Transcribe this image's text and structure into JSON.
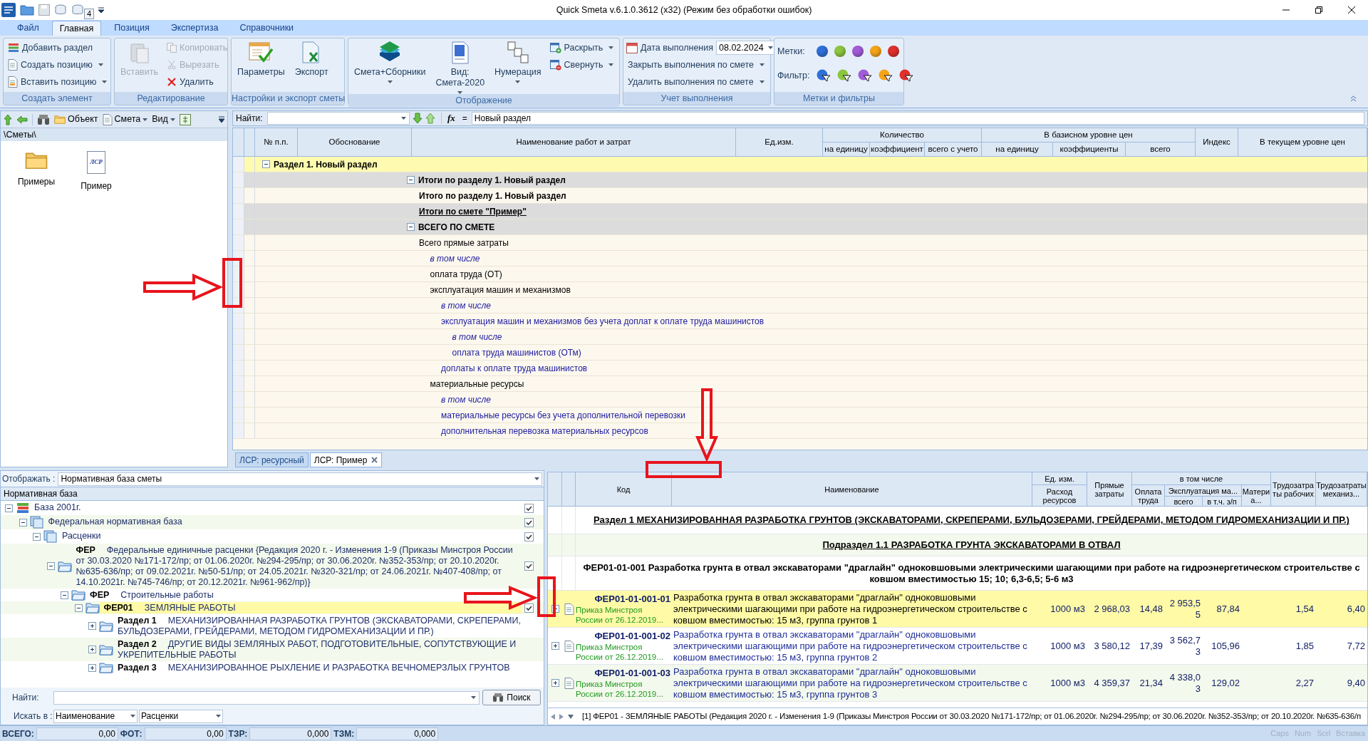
{
  "window": {
    "title": "Quick Smeta v.6.1.0.3612 (x32) (Режим без обработки ошибок)",
    "quick_access_badge": "4"
  },
  "ribbon": {
    "tabs": [
      {
        "label": "Файл",
        "selected": false
      },
      {
        "label": "Главная",
        "selected": true
      },
      {
        "label": "Позиция",
        "selected": false
      },
      {
        "label": "Экспертиза",
        "selected": false
      },
      {
        "label": "Справочники",
        "selected": false
      }
    ],
    "groups": [
      {
        "title": "Создать элемент",
        "columns": [
          [
            {
              "kind": "small",
              "label": "Добавить раздел",
              "disabled": false,
              "dropdown": false
            },
            {
              "kind": "small",
              "label": "Создать позицию",
              "disabled": false,
              "dropdown": true
            },
            {
              "kind": "small",
              "label": "Вставить позицию",
              "disabled": false,
              "dropdown": true
            }
          ]
        ]
      },
      {
        "title": "Редактирование",
        "columns": [
          [
            {
              "kind": "large",
              "label": "Вставить",
              "disabled": true,
              "dropdown": false
            }
          ],
          [
            {
              "kind": "small",
              "label": "Копировать",
              "disabled": true,
              "dropdown": false
            },
            {
              "kind": "small",
              "label": "Вырезать",
              "disabled": true,
              "dropdown": false
            },
            {
              "kind": "small",
              "label": "Удалить",
              "disabled": false,
              "dropdown": false
            }
          ]
        ]
      },
      {
        "title": "Настройки и экспорт сметы",
        "columns": [
          [
            {
              "kind": "large",
              "label": "Параметры",
              "disabled": false,
              "dropdown": false
            }
          ],
          [
            {
              "kind": "large",
              "label": "Экспорт",
              "disabled": false,
              "dropdown": false
            }
          ]
        ]
      },
      {
        "title": "Отображение",
        "columns": [
          [
            {
              "kind": "large",
              "label": "Смета+Сборники",
              "disabled": false,
              "dropdown": true
            }
          ],
          [
            {
              "kind": "large",
              "label": "Вид: Смета-2020",
              "disabled": false,
              "dropdown": true
            }
          ],
          [
            {
              "kind": "large",
              "label": "Нумерация",
              "disabled": false,
              "dropdown": true
            }
          ],
          [
            {
              "kind": "small",
              "label": "Раскрыть",
              "disabled": false,
              "dropdown": true
            },
            {
              "kind": "small",
              "label": "Свернуть",
              "disabled": false,
              "dropdown": true
            }
          ]
        ]
      },
      {
        "title": "Учет выполнения",
        "columns": [
          [
            {
              "kind": "date",
              "label": "Дата выполнения",
              "value": "08.02.2024"
            },
            {
              "kind": "small",
              "label": "Закрыть выполнения по смете",
              "disabled": false,
              "dropdown": true
            },
            {
              "kind": "small",
              "label": "Удалить выполнения по смете",
              "disabled": false,
              "dropdown": true
            }
          ]
        ]
      },
      {
        "title": "Метки и фильтры",
        "columns": [
          [
            {
              "kind": "marks",
              "label": "Метки:",
              "items": [
                {
                  "color": "#2f6fd8"
                },
                {
                  "color": "#8cc63f"
                },
                {
                  "color": "#a35bd8"
                },
                {
                  "color": "#f5a418"
                },
                {
                  "color": "#e0302c"
                }
              ]
            },
            {
              "kind": "filters",
              "label": "Фильтр:",
              "items": [
                {
                  "color": "#2f6fd8"
                },
                {
                  "color": "#8cc63f"
                },
                {
                  "color": "#a35bd8"
                },
                {
                  "color": "#f5a418"
                },
                {
                  "color": "#e0302c"
                }
              ]
            }
          ]
        ]
      }
    ]
  },
  "explorer": {
    "toolbar": [
      {
        "label": "Объект",
        "dropdown": false
      },
      {
        "label": "Смета",
        "dropdown": true
      },
      {
        "label": "Вид",
        "dropdown": true
      }
    ],
    "path": "\\Сметы\\",
    "items": [
      {
        "kind": "folder",
        "label": "Примеры"
      },
      {
        "kind": "estimate",
        "label": "Пример",
        "badge": "ЛСР"
      }
    ]
  },
  "estimate": {
    "find_label": "Найти:",
    "fx": "fx",
    "equals": "=",
    "formula": "Новый раздел",
    "columns": [
      {
        "label": "№ п.п."
      },
      {
        "label": "Обоснование"
      },
      {
        "label": "Наименование работ и затрат"
      },
      {
        "label": "Ед.изм."
      },
      {
        "label": "Количество",
        "sub": [
          "на единицу",
          "коэффициент",
          "всего с учето"
        ]
      },
      {
        "label": "В базисном уровне цен",
        "sub": [
          "на единицу",
          "коэффициенты",
          "всего"
        ]
      },
      {
        "label": "Индекс"
      },
      {
        "label": "В текущем уровне цен"
      }
    ],
    "rows": [
      {
        "kind": "section",
        "text": "Раздел 1. Новый раздел",
        "expanded": true
      },
      {
        "kind": "group",
        "text": "Итоги по разделу 1. Новый раздел",
        "expanded": true,
        "children": [
          {
            "kind": "total",
            "text": "Итого по разделу 1. Новый раздел"
          }
        ]
      },
      {
        "kind": "estimate-total",
        "text": "Итоги по смете \"Пример\""
      },
      {
        "kind": "group",
        "text": "ВСЕГО ПО СМЕТЕ",
        "expanded": true,
        "children": [
          {
            "kind": "plain",
            "text": "Всего прямые затраты",
            "children": [
              {
                "kind": "note",
                "text": "в том числе"
              },
              {
                "kind": "plain",
                "text": "оплата труда (ОТ)"
              },
              {
                "kind": "plain",
                "text": "эксплуатация машин и механизмов",
                "children": [
                  {
                    "kind": "note",
                    "text": "в том числе"
                  },
                  {
                    "kind": "detail",
                    "text": "эксплуатация машин и механизмов без учета доплат к оплате труда машинистов",
                    "children": [
                      {
                        "kind": "note",
                        "text": "в том числе"
                      },
                      {
                        "kind": "detail",
                        "text": "оплата труда машинистов (ОТм)"
                      }
                    ]
                  },
                  {
                    "kind": "detail",
                    "text": "доплаты к оплате труда машинистов"
                  }
                ]
              },
              {
                "kind": "plain",
                "text": "материальные ресурсы",
                "children": [
                  {
                    "kind": "note",
                    "text": "в том числе"
                  },
                  {
                    "kind": "detail",
                    "text": "материальные ресурсы без учета дополнительной перевозки"
                  },
                  {
                    "kind": "detail",
                    "text": "дополнительная перевозка материальных ресурсов"
                  }
                ]
              }
            ]
          }
        ]
      }
    ]
  },
  "doc_tabs": [
    {
      "label": "ЛСР: ресурсный",
      "selected": false,
      "closable": false
    },
    {
      "label": "ЛСР: Пример",
      "selected": true,
      "closable": true
    }
  ],
  "norm_base": {
    "show_label": "Отображать :",
    "show_value": "Нормативная база сметы",
    "header": "Нормативная база",
    "tree": [
      {
        "kind": "database",
        "name": "База 2001г.",
        "checked": true,
        "expanded": true,
        "selected": false,
        "children": [
          {
            "kind": "base",
            "name": "Федеральная нормативная база",
            "checked": true,
            "expanded": true,
            "selected": false,
            "children": [
              {
                "kind": "base",
                "name": "Расценки",
                "checked": true,
                "expanded": true,
                "selected": false,
                "children": [
                  {
                    "kind": "folder",
                    "code": "ФЕР",
                    "name": "Федеральные единичные расценки {Редакция 2020 г. - Изменения 1-9 (Приказы Минстроя России от 30.03.2020 №171-172/пр; от 01.06.2020г. №294-295/пр; от 30.06.2020г. №352-353/пр; от 20.10.2020г. №635-636/пр; от 09.02.2021г. №50-51/пр; от 24.05.2021г. №320-321/пр; от 24.06.2021г. №407-408/пр; от 14.10.2021г. №745-746/пр; от 20.12.2021г. №961-962/пр)}",
                    "checked": true,
                    "expanded": true,
                    "selected": false,
                    "children": [
                      {
                        "kind": "folder",
                        "code": "ФЕР",
                        "name": "Строительные работы",
                        "expanded": true,
                        "selected": false,
                        "children": [
                          {
                            "kind": "folder",
                            "code": "ФЕР01",
                            "name": "ЗЕМЛЯНЫЕ РАБОТЫ",
                            "checked": true,
                            "expanded": true,
                            "selected": true,
                            "children": [
                              {
                                "kind": "folder",
                                "code": "Раздел 1",
                                "name": "МЕХАНИЗИРОВАННАЯ РАЗРАБОТКА ГРУНТОВ (ЭКСКАВАТОРАМИ, СКРЕПЕРАМИ, БУЛЬДОЗЕРАМИ, ГРЕЙДЕРАМИ, МЕТОДОМ ГИДРОМЕХАНИЗАЦИИ И ПР.)",
                                "expanded": false,
                                "selected": false
                              },
                              {
                                "kind": "folder",
                                "code": "Раздел 2",
                                "name": "ДРУГИЕ ВИДЫ ЗЕМЛЯНЫХ РАБОТ, ПОДГОТОВИТЕЛЬНЫЕ, СОПУТСТВУЮЩИЕ И УКРЕПИТЕЛЬНЫЕ РАБОТЫ",
                                "expanded": false,
                                "selected": false
                              },
                              {
                                "kind": "folder",
                                "code": "Раздел 3",
                                "name": "МЕХАНИЗИРОВАННОЕ РЫХЛЕНИЕ И РАЗРАБОТКА ВЕЧНОМЕРЗЛЫХ ГРУНТОВ",
                                "expanded": false,
                                "selected": false
                              }
                            ]
                          }
                        ]
                      }
                    ]
                  }
                ]
              }
            ]
          }
        ]
      }
    ],
    "find_label": "Найти:",
    "search_button": "Поиск",
    "search_in_label": "Искать в :",
    "search_in": "Наименование",
    "search_scope": "Расценки"
  },
  "rates": {
    "header": {
      "code": "Код",
      "name": "Наименование",
      "unit": "Ед. изм.",
      "consumption": "Расход ресурсов",
      "direct": "Прямые затраты",
      "including": "в том числе",
      "labor": "Оплата труда",
      "operation": "Эксплуатация ма...",
      "op_total": "всего",
      "op_wages": "в т.ч. з/п",
      "materials": "Материа...",
      "workers": "Трудозатраты рабочих",
      "machinists": "Трудозатраты механиз..."
    },
    "rows": [
      {
        "kind": "section",
        "text": "Раздел 1 МЕХАНИЗИРОВАННАЯ РАЗРАБОТКА ГРУНТОВ (ЭКСКАВАТОРАМИ, СКРЕПЕРАМИ, БУЛЬДОЗЕРАМИ, ГРЕЙДЕРАМИ, МЕТОДОМ ГИДРОМЕХАНИЗАЦИИ И ПР.)"
      },
      {
        "kind": "subsection",
        "text": "Подраздел 1.1 РАЗРАБОТКА ГРУНТА ЭКСКАВАТОРАМИ В ОТВАЛ"
      },
      {
        "kind": "table",
        "text": "ФЕР01-01-001 Разработка грунта в отвал экскаваторами \"драглайн\" одноковшовыми электрическими шагающими при работе на гидроэнергетическом строительстве с ковшом вместимостью 15; 10; 6,3-6,5; 5-6 м3"
      },
      {
        "kind": "item",
        "selected": true,
        "expanded": false,
        "code": "ФЕР01-01-001-01",
        "source": "Приказ Минстроя России от 26.12.2019...",
        "name": "Разработка грунта в отвал экскаваторами \"драглайн\" одноковшовыми электрическими шагающими при работе на гидроэнергетическом строительстве с ковшом вместимостью: 15 м3, группа грунтов 1",
        "unit": "1000 м3",
        "direct": "2 968,03",
        "labor": "14,48",
        "op_total": "2 953,55",
        "op_wages": "87,84",
        "workers": "1,54",
        "machinists": "6,40"
      },
      {
        "kind": "item",
        "selected": false,
        "expanded": false,
        "code": "ФЕР01-01-001-02",
        "source": "Приказ Минстроя России от 26.12.2019...",
        "name": "Разработка грунта в отвал экскаваторами \"драглайн\" одноковшовыми электрическими шагающими при работе на гидроэнергетическом строительстве с ковшом вместимостью: 15 м3, группа грунтов 2",
        "unit": "1000 м3",
        "direct": "3 580,12",
        "labor": "17,39",
        "op_total": "3 562,73",
        "op_wages": "105,96",
        "workers": "1,85",
        "machinists": "7,72"
      },
      {
        "kind": "item",
        "selected": false,
        "expanded": false,
        "code": "ФЕР01-01-001-03",
        "source": "Приказ Минстроя России от 26.12.2019...",
        "name": "Разработка грунта в отвал экскаваторами \"драглайн\" одноковшовыми электрическими шагающими при работе на гидроэнергетическом строительстве с ковшом вместимостью: 15 м3, группа грунтов 3",
        "unit": "1000 м3",
        "direct": "4 359,37",
        "labor": "21,34",
        "op_total": "4 338,03",
        "op_wages": "129,02",
        "workers": "2,27",
        "machinists": "9,40"
      }
    ],
    "footer": "[1] ФЕР01 - ЗЕМЛЯНЫЕ РАБОТЫ (Редакция 2020 г. - Изменения 1-9 (Приказы Минстроя России от 30.03.2020 №171-172/пр; от 01.06.2020г. №294-295/пр; от 30.06.2020г. №352-353/пр; от 20.10.2020г. №635-636/п"
  },
  "status_bar": {
    "totals": [
      {
        "label": "ВСЕГО:",
        "value": "0,00"
      },
      {
        "label": "ФОТ:",
        "value": "0,00"
      },
      {
        "label": "ТЗР:",
        "value": "0,000"
      },
      {
        "label": "ТЗМ:",
        "value": "0,000"
      }
    ],
    "indicators": [
      "Caps",
      "Num",
      "Scrl",
      "Вставка"
    ]
  }
}
